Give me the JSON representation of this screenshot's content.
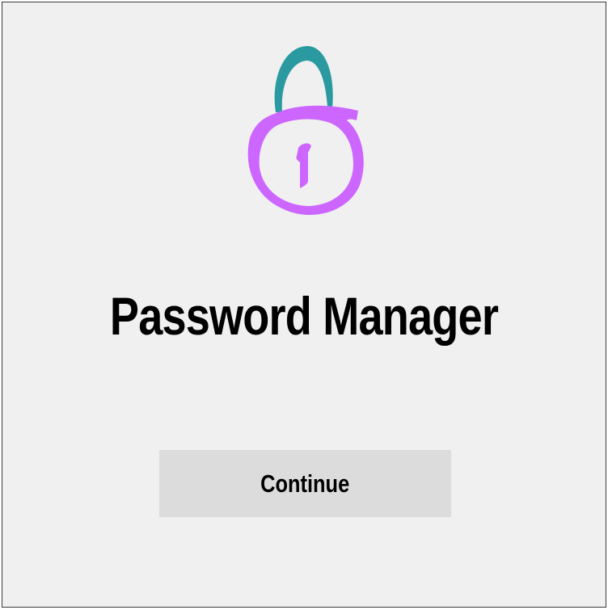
{
  "app": {
    "title": "Password Manager"
  },
  "logo": {
    "icon": "lock-icon",
    "shackle_color": "#2a9aa0",
    "body_color": "#cc66ff"
  },
  "actions": {
    "continue_label": "Continue"
  },
  "colors": {
    "background": "#f0f0f0",
    "button_background": "#dcdcdc",
    "text": "#000000",
    "border": "#3a3a3a"
  }
}
